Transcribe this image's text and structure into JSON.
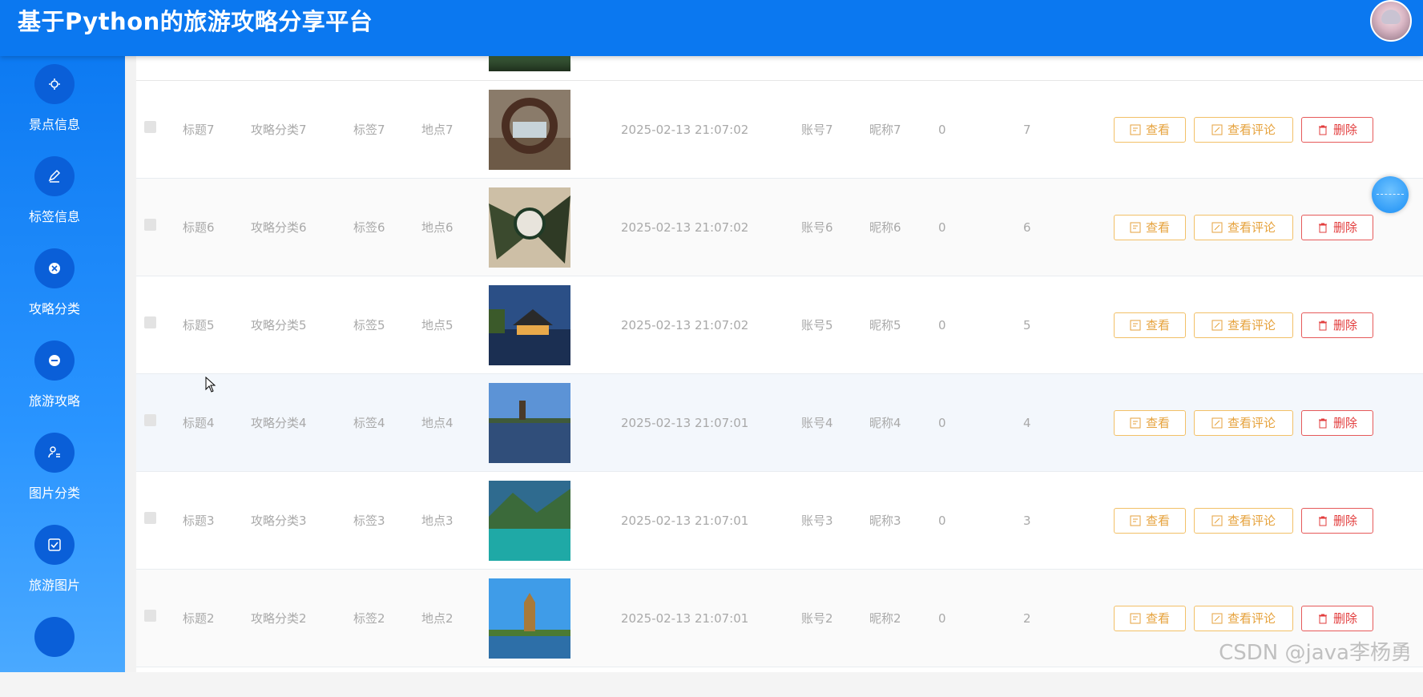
{
  "header": {
    "title": "基于Python的旅游攻略分享平台"
  },
  "sidebar": {
    "items": [
      {
        "label": "景点信息",
        "icon": "scenic-icon"
      },
      {
        "label": "标签信息",
        "icon": "edit-icon"
      },
      {
        "label": "攻略分类",
        "icon": "close-circle-icon"
      },
      {
        "label": "旅游攻略",
        "icon": "minus-circle-icon"
      },
      {
        "label": "图片分类",
        "icon": "user-list-icon"
      },
      {
        "label": "旅游图片",
        "icon": "checkbox-icon"
      }
    ]
  },
  "table": {
    "actions": {
      "view": "查看",
      "comments": "查看评论",
      "delete": "删除"
    },
    "rows": [
      {
        "title": "标题7",
        "category": "攻略分类7",
        "tag": "标签7",
        "location": "地点7",
        "time": "2025-02-13 21:07:02",
        "account": "账号7",
        "nickname": "昵称7",
        "col_a": "0",
        "col_b": "7"
      },
      {
        "title": "标题6",
        "category": "攻略分类6",
        "tag": "标签6",
        "location": "地点6",
        "time": "2025-02-13 21:07:02",
        "account": "账号6",
        "nickname": "昵称6",
        "col_a": "0",
        "col_b": "6"
      },
      {
        "title": "标题5",
        "category": "攻略分类5",
        "tag": "标签5",
        "location": "地点5",
        "time": "2025-02-13 21:07:02",
        "account": "账号5",
        "nickname": "昵称5",
        "col_a": "0",
        "col_b": "5"
      },
      {
        "title": "标题4",
        "category": "攻略分类4",
        "tag": "标签4",
        "location": "地点4",
        "time": "2025-02-13 21:07:01",
        "account": "账号4",
        "nickname": "昵称4",
        "col_a": "0",
        "col_b": "4"
      },
      {
        "title": "标题3",
        "category": "攻略分类3",
        "tag": "标签3",
        "location": "地点3",
        "time": "2025-02-13 21:07:01",
        "account": "账号3",
        "nickname": "昵称3",
        "col_a": "0",
        "col_b": "3"
      },
      {
        "title": "标题2",
        "category": "攻略分类2",
        "tag": "标签2",
        "location": "地点2",
        "time": "2025-02-13 21:07:01",
        "account": "账号2",
        "nickname": "昵称2",
        "col_a": "0",
        "col_b": "2"
      }
    ]
  },
  "watermark": "CSDN @java李杨勇",
  "colors": {
    "header": "#0b78f0",
    "warning": "#e6a23c",
    "danger": "#e23c3c"
  }
}
